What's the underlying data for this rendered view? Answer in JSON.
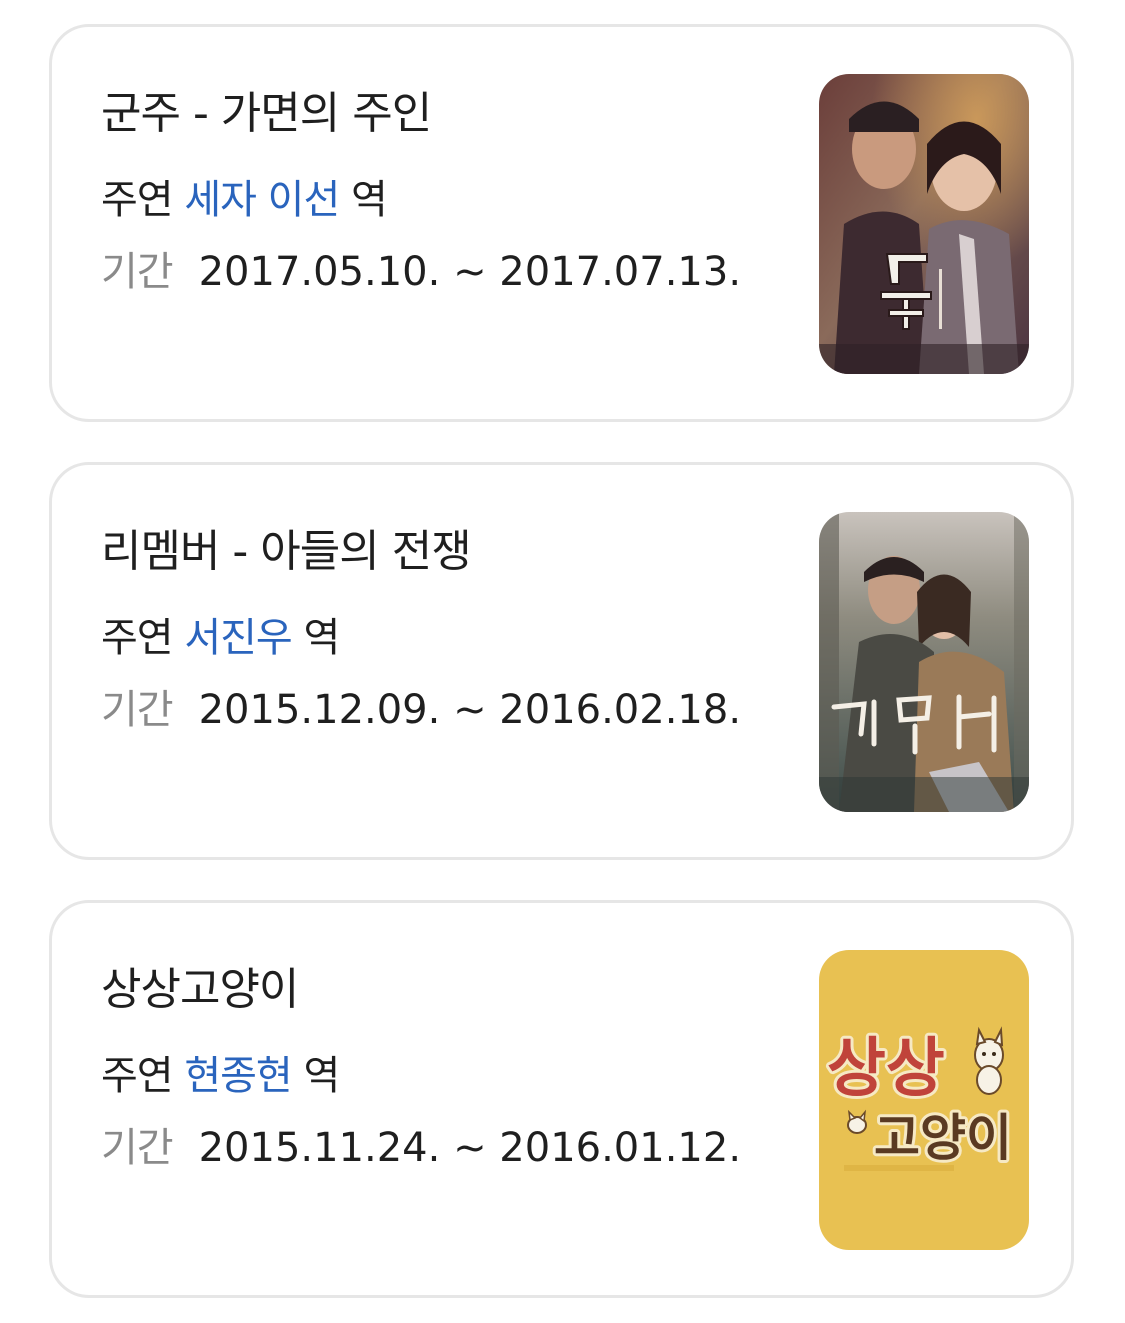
{
  "labels": {
    "role_prefix": "주연",
    "role_suffix": "역",
    "period": "기간"
  },
  "dramas": [
    {
      "title": "군주 - 가면의 주인",
      "role": "세자 이선",
      "period": "2017.05.10. ~ 2017.07.13.",
      "poster": {
        "text": "군주"
      }
    },
    {
      "title": "리멤버 - 아들의 전쟁",
      "role": "서진우",
      "period": "2015.12.09. ~ 2016.02.18.",
      "poster": {
        "text": "리멤버"
      }
    },
    {
      "title": "상상고양이",
      "role": "현종현",
      "period": "2015.11.24. ~ 2016.01.12.",
      "poster": {
        "text_line1": "상상",
        "text_line2": "고양이"
      }
    }
  ],
  "colors": {
    "link": "#2a64bd",
    "text": "#1f1f1f",
    "muted": "#8a8a8a",
    "border": "#e6e6e6",
    "poster3_bg": "#e8c152"
  }
}
